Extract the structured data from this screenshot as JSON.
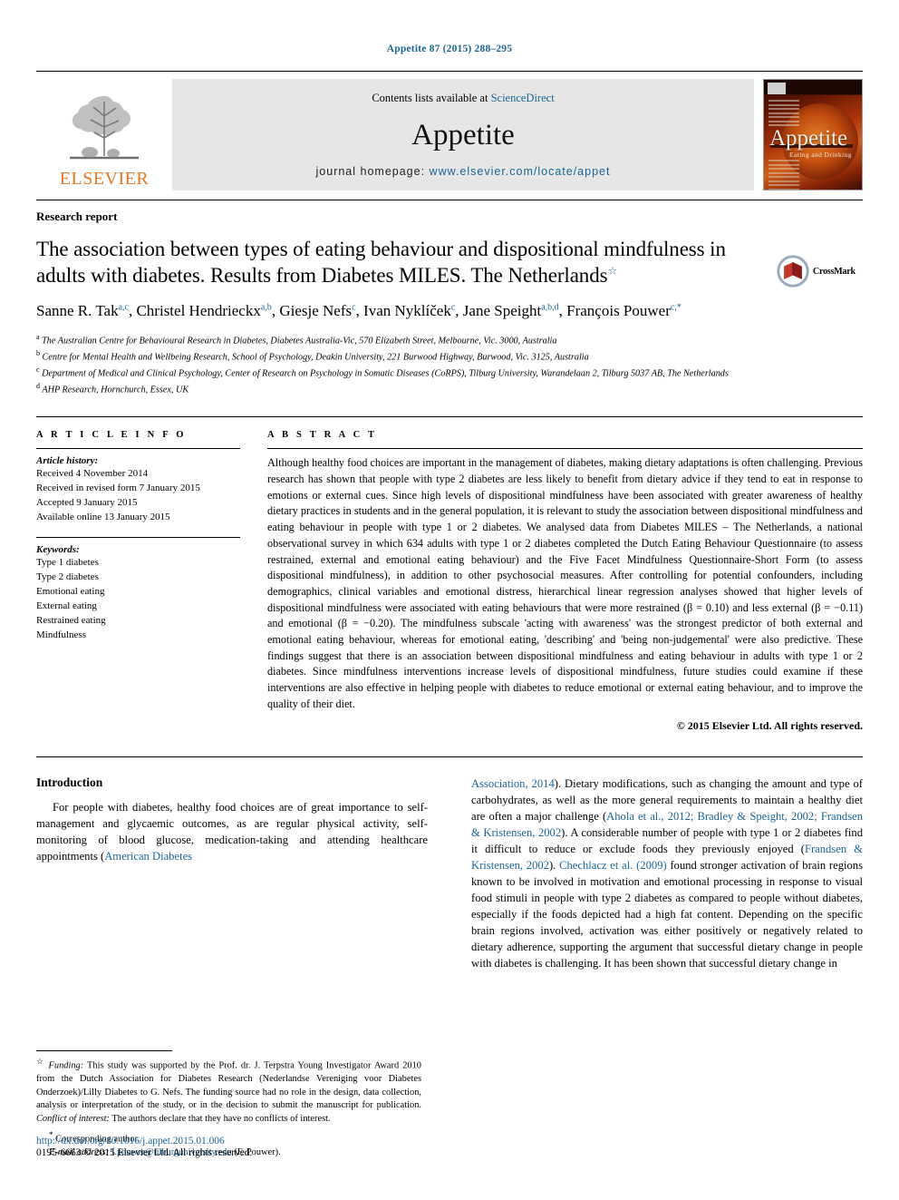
{
  "running_head": "Appetite 87 (2015) 288–295",
  "masthead": {
    "contents_prefix": "Contents lists available at ",
    "sciencedirect": "ScienceDirect",
    "journal_name": "Appetite",
    "homepage_label": "journal homepage:",
    "homepage_url": "www.elsevier.com/locate/appet",
    "elsevier_wordmark": "ELSEVIER",
    "cover_title": "Appetite",
    "cover_subtitle": "Eating and Drinking"
  },
  "article": {
    "kicker": "Research report",
    "title": "The association between types of eating behaviour and dispositional mindfulness in adults with diabetes. Results from Diabetes MILES. The Netherlands",
    "title_footnote_mark": "☆",
    "crossmark_label": "CrossMark",
    "authors": [
      {
        "name": "Sanne R. Tak",
        "marks": "a,c",
        "sep": ", "
      },
      {
        "name": "Christel Hendrieckx",
        "marks": "a,b",
        "sep": ", "
      },
      {
        "name": "Giesje Nefs",
        "marks": "c",
        "sep": ", "
      },
      {
        "name": "Ivan Nyklíček",
        "marks": "c",
        "sep": ", "
      },
      {
        "name": "Jane Speight",
        "marks": "a,b,d",
        "sep": ", "
      },
      {
        "name": "François Pouwer",
        "marks": "c,*",
        "sep": ""
      }
    ],
    "affiliations": [
      {
        "mark": "a",
        "text": "The Australian Centre for Behavioural Research in Diabetes, Diabetes Australia-Vic, 570 Elizabeth Street, Melbourne, Vic. 3000, Australia"
      },
      {
        "mark": "b",
        "text": "Centre for Mental Health and Wellbeing Research, School of Psychology, Deakin University, 221 Burwood Highway, Burwood, Vic. 3125, Australia"
      },
      {
        "mark": "c",
        "text": "Department of Medical and Clinical Psychology, Center of Research on Psychology in Somatic Diseases (CoRPS), Tilburg University, Warandelaan 2, Tilburg 5037 AB, The Netherlands"
      },
      {
        "mark": "d",
        "text": "AHP Research, Hornchurch, Essex, UK"
      }
    ]
  },
  "article_info": {
    "heading": "A R T I C L E   I N F O",
    "history_label": "Article history:",
    "history": [
      "Received 4 November 2014",
      "Received in revised form 7 January 2015",
      "Accepted 9 January 2015",
      "Available online 13 January 2015"
    ],
    "keywords_label": "Keywords:",
    "keywords": [
      "Type 1 diabetes",
      "Type 2 diabetes",
      "Emotional eating",
      "External eating",
      "Restrained eating",
      "Mindfulness"
    ]
  },
  "abstract": {
    "heading": "A B S T R A C T",
    "text": "Although healthy food choices are important in the management of diabetes, making dietary adaptations is often challenging. Previous research has shown that people with type 2 diabetes are less likely to benefit from dietary advice if they tend to eat in response to emotions or external cues. Since high levels of dispositional mindfulness have been associated with greater awareness of healthy dietary practices in students and in the general population, it is relevant to study the association between dispositional mindfulness and eating behaviour in people with type 1 or 2 diabetes. We analysed data from Diabetes MILES – The Netherlands, a national observational survey in which 634 adults with type 1 or 2 diabetes completed the Dutch Eating Behaviour Questionnaire (to assess restrained, external and emotional eating behaviour) and the Five Facet Mindfulness Questionnaire-Short Form (to assess dispositional mindfulness), in addition to other psychosocial measures. After controlling for potential confounders, including demographics, clinical variables and emotional distress, hierarchical linear regression analyses showed that higher levels of dispositional mindfulness were associated with eating behaviours that were more restrained (β = 0.10) and less external (β = −0.11) and emotional (β = −0.20). The mindfulness subscale 'acting with awareness' was the strongest predictor of both external and emotional eating behaviour, whereas for emotional eating, 'describing' and 'being non-judgemental' were also predictive. These findings suggest that there is an association between dispositional mindfulness and eating behaviour in adults with type 1 or 2 diabetes. Since mindfulness interventions increase levels of dispositional mindfulness, future studies could examine if these interventions are also effective in helping people with diabetes to reduce emotional or external eating behaviour, and to improve the quality of their diet.",
    "copyright": "© 2015 Elsevier Ltd. All rights reserved."
  },
  "introduction": {
    "heading": "Introduction",
    "left_paragraph_plain": "For people with diabetes, healthy food choices are of great importance to self-management and glycaemic outcomes, as are regular physical activity, self-monitoring of blood glucose, medication-taking and attending healthcare appointments (",
    "left_ref_tail": "American Diabetes",
    "right_ref_head": "Association, 2014",
    "right_part_1": "). Dietary modifications, such as changing the amount and type of carbohydrates, as well as the more general requirements to maintain a healthy diet are often a major challenge (",
    "right_ref_2": "Ahola et al., 2012; Bradley & Speight, 2002; Frandsen & Kristensen, 2002",
    "right_part_2": "). A considerable number of people with type 1 or 2 diabetes find it difficult to reduce or exclude foods they previously enjoyed (",
    "right_ref_3": "Frandsen & Kristensen, 2002",
    "right_part_3": "). ",
    "right_ref_4": "Chechlacz et al. (2009)",
    "right_part_4": " found stronger activation of brain regions known to be involved in motivation and emotional processing in response to visual food stimuli in people with type 2 diabetes as compared to people without diabetes, especially if the foods depicted had a high fat content. Depending on the specific brain regions involved, activation was either positively or negatively related to dietary adherence, supporting the argument that successful dietary change in people with diabetes is challenging. It has been shown that successful dietary change in"
  },
  "footnotes": {
    "funding_mark": "☆",
    "funding_label": "Funding:",
    "funding_text_1": " This study was supported by the Prof. dr. J. Terpstra Young Investigator Award 2010 from the Dutch Association for Diabetes Research (Nederlandse Vereniging voor Diabetes Onderzoek)/Lilly Diabetes to G. Nefs. The funding source had no role in the design, data collection, analysis or interpretation of the study, or in the decision to submit the manuscript for publication. ",
    "coi_label": "Conflict of interest:",
    "coi_text": " The authors declare that they have no conflicts of interest.",
    "corresponding_mark": "*",
    "corresponding_text": "Corresponding author.",
    "email_label": "E-mail address:",
    "email": "f.pouwer@tilburguniversity.edu",
    "email_suffix": " (F. Pouwer)."
  },
  "footer": {
    "doi": "http://dx.doi.org/10.1016/j.appet.2015.01.006",
    "issn": "0195-6663/© 2015 Elsevier Ltd. All rights reserved."
  },
  "colors": {
    "link_blue": "#1a6496",
    "elsevier_orange": "#E87722",
    "band_grey": "#e6e6e6"
  }
}
